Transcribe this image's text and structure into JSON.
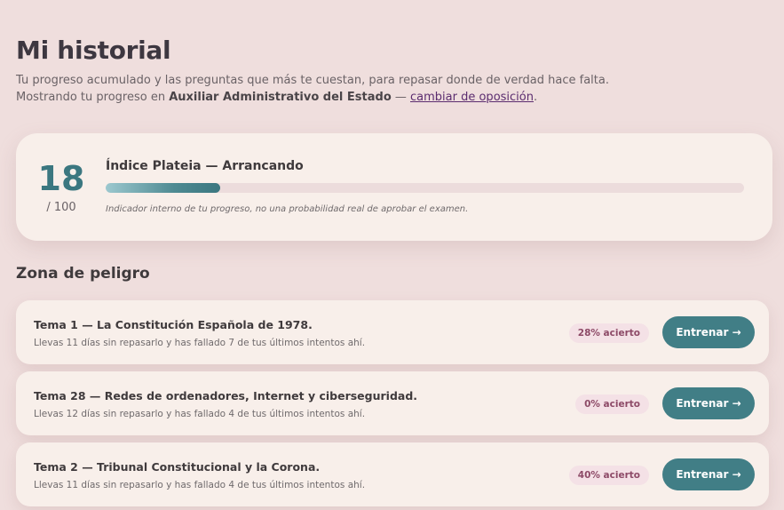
{
  "header": {
    "title": "Mi historial",
    "subtitle_line1": "Tu progreso acumulado y las preguntas que más te cuestan, para repasar donde de verdad hace falta.",
    "subtitle_line2_prefix": "Mostrando tu progreso en ",
    "exam_name": "Auxiliar Administrativo del Estado",
    "subtitle_separator": " — ",
    "change_link": "cambiar de oposición",
    "subtitle_suffix": "."
  },
  "score": {
    "value": "18",
    "max": "/ 100",
    "progress_percent": 18,
    "label": "Índice Plateia — Arrancando",
    "note": "Indicador interno de tu progreso, no una probabilidad real de aprobar el examen."
  },
  "danger_zone": {
    "title": "Zona de peligro",
    "items": [
      {
        "title": "Tema 1 — La Constitución Española de 1978.",
        "description": "Llevas 11 días sin repasarlo y has fallado 7 de tus últimos intentos ahí.",
        "badge": "28% acierto",
        "button": "Entrenar →"
      },
      {
        "title": "Tema 28 — Redes de ordenadores, Internet y ciberseguridad.",
        "description": "Llevas 12 días sin repasarlo y has fallado 4 de tus últimos intentos ahí.",
        "badge": "0% acierto",
        "button": "Entrenar →"
      },
      {
        "title": "Tema 2 — Tribunal Constitucional y la Corona.",
        "description": "Llevas 11 días sin repasarlo y has fallado 4 de tus últimos intentos ahí.",
        "badge": "40% acierto",
        "button": "Entrenar →"
      }
    ]
  },
  "colors": {
    "background": "#efdedd",
    "card": "#f8efea",
    "accent": "#417e86",
    "badge_text": "#8d4a67",
    "link": "#5b2c6f"
  }
}
